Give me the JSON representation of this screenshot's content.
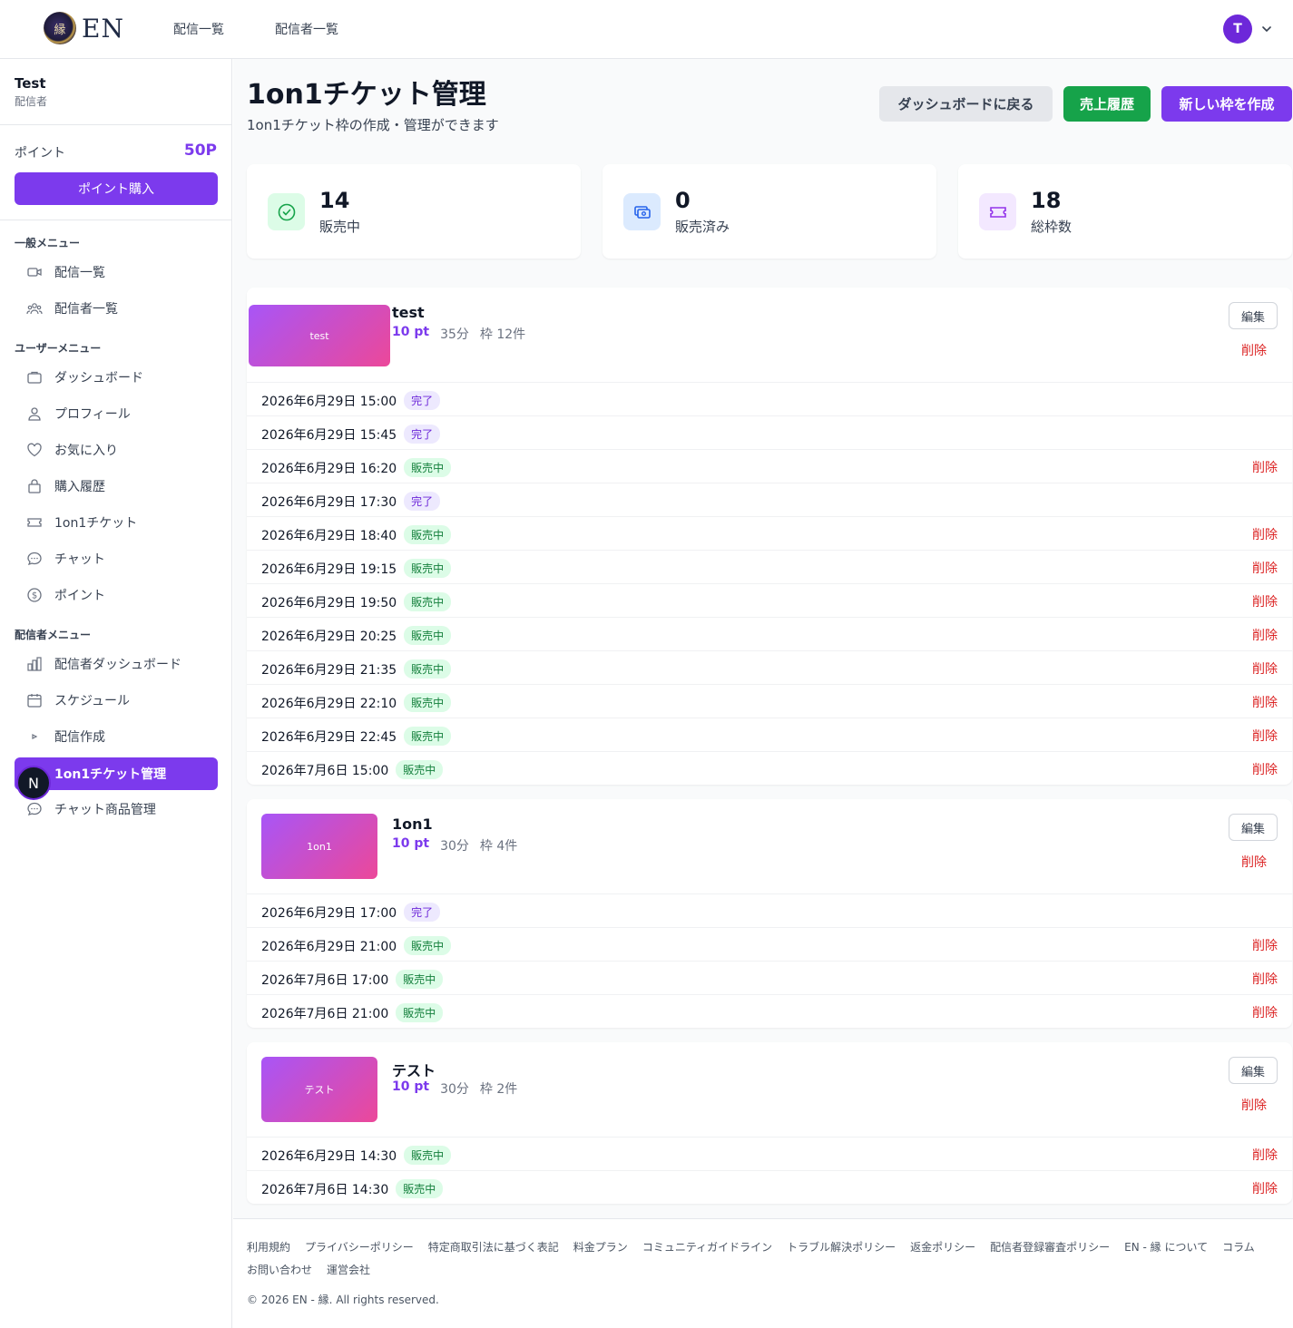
{
  "header": {
    "logo_text": "EN",
    "logo_mark": "縁",
    "nav": [
      "配信一覧",
      "配信者一覧"
    ],
    "avatar_initial": "T"
  },
  "sidebar": {
    "user_name": "Test",
    "user_role": "配信者",
    "points_label": "ポイント",
    "points_value": "50P",
    "buy_button": "ポイント購入",
    "sections": {
      "general": "一般メニュー",
      "user": "ユーザーメニュー",
      "streamer": "配信者メニュー"
    },
    "general_items": [
      "配信一覧",
      "配信者一覧"
    ],
    "user_items": [
      "ダッシュボード",
      "プロフィール",
      "お気に入り",
      "購入履歴",
      "1on1チケット",
      "チャット",
      "ポイント"
    ],
    "streamer_items": [
      "配信者ダッシュボード",
      "スケジュール",
      "配信作成",
      "1on1チケット管理",
      "チャット商品管理"
    ],
    "floating_badge": "N"
  },
  "main": {
    "title": "1on1チケット管理",
    "subtitle": "1on1チケット枠の作成・管理ができます",
    "buttons": {
      "back": "ダッシュボードに戻る",
      "sales": "売上履歴",
      "create": "新しい枠を作成"
    },
    "stats": [
      {
        "value": "14",
        "label": "販売中",
        "color": "#16a34a",
        "bg": "#dcfce7",
        "icon": "check-circle-icon"
      },
      {
        "value": "0",
        "label": "販売済み",
        "color": "#2563eb",
        "bg": "#dbeafe",
        "icon": "money-icon"
      },
      {
        "value": "18",
        "label": "総枠数",
        "color": "#9333ea",
        "bg": "#f3e8ff",
        "icon": "ticket-icon"
      }
    ],
    "edit_label": "編集",
    "delete_label": "削除",
    "tickets": [
      {
        "thumb": "test",
        "title": "test",
        "points": "10 pt",
        "duration": "35分",
        "slots": "枠 12件",
        "rows": [
          {
            "date": "2026年6月29日 15:00",
            "status": "完了",
            "deletable": false
          },
          {
            "date": "2026年6月29日 15:45",
            "status": "完了",
            "deletable": false
          },
          {
            "date": "2026年6月29日 16:20",
            "status": "販売中",
            "deletable": true
          },
          {
            "date": "2026年6月29日 17:30",
            "status": "完了",
            "deletable": false
          },
          {
            "date": "2026年6月29日 18:40",
            "status": "販売中",
            "deletable": true
          },
          {
            "date": "2026年6月29日 19:15",
            "status": "販売中",
            "deletable": true
          },
          {
            "date": "2026年6月29日 19:50",
            "status": "販売中",
            "deletable": true
          },
          {
            "date": "2026年6月29日 20:25",
            "status": "販売中",
            "deletable": true
          },
          {
            "date": "2026年6月29日 21:35",
            "status": "販売中",
            "deletable": true
          },
          {
            "date": "2026年6月29日 22:10",
            "status": "販売中",
            "deletable": true
          },
          {
            "date": "2026年6月29日 22:45",
            "status": "販売中",
            "deletable": true
          },
          {
            "date": "2026年7月6日 15:00",
            "status": "販売中",
            "deletable": true
          }
        ]
      },
      {
        "thumb": "1on1",
        "title": "1on1",
        "points": "10 pt",
        "duration": "30分",
        "slots": "枠 4件",
        "rows": [
          {
            "date": "2026年6月29日 17:00",
            "status": "完了",
            "deletable": false
          },
          {
            "date": "2026年6月29日 21:00",
            "status": "販売中",
            "deletable": true
          },
          {
            "date": "2026年7月6日 17:00",
            "status": "販売中",
            "deletable": true
          },
          {
            "date": "2026年7月6日 21:00",
            "status": "販売中",
            "deletable": true
          }
        ]
      },
      {
        "thumb": "テスト",
        "title": "テスト",
        "points": "10 pt",
        "duration": "30分",
        "slots": "枠 2件",
        "rows": [
          {
            "date": "2026年6月29日 14:30",
            "status": "販売中",
            "deletable": true
          },
          {
            "date": "2026年7月6日 14:30",
            "status": "販売中",
            "deletable": true
          }
        ]
      }
    ]
  },
  "footer": {
    "links": [
      "利用規約",
      "プライバシーポリシー",
      "特定商取引法に基づく表記",
      "料金プラン",
      "コミュニティガイドライン",
      "トラブル解決ポリシー",
      "返金ポリシー",
      "配信者登録審査ポリシー",
      "EN - 縁 について",
      "コラム",
      "お問い合わせ",
      "運営会社"
    ],
    "copyright": "© 2026 EN - 縁. All rights reserved."
  },
  "colors": {
    "accent": "#7c3aed",
    "success": "#16a34a",
    "danger": "#dc2626"
  }
}
